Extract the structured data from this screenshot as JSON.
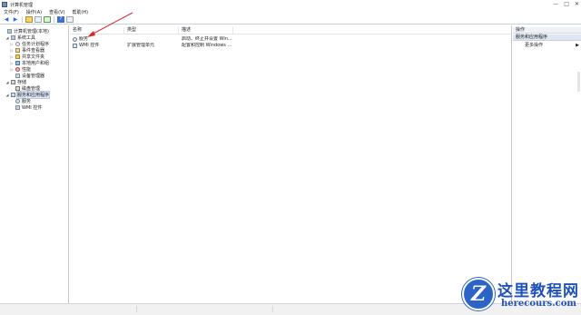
{
  "window": {
    "title": "计算机管理",
    "controls": [
      "—",
      "□",
      "✕"
    ]
  },
  "menu": [
    "文件(F)",
    "操作(A)",
    "查看(V)",
    "帮助(H)"
  ],
  "toolbar": {
    "buttons": [
      "back-arrow-icon",
      "forward-arrow-icon",
      "folder-icon",
      "console-tree-icon",
      "export-icon",
      "help-icon",
      "properties-icon"
    ],
    "glyphs": {
      "back": "◀",
      "forward": "▶",
      "help": "?"
    }
  },
  "tree": [
    {
      "label": "计算机管理(本地)",
      "level": 0,
      "arrow": "",
      "icon": "computer-icon"
    },
    {
      "label": "系统工具",
      "level": 1,
      "arrow": "◢",
      "icon": "system-tools-icon"
    },
    {
      "label": "任务计划程序",
      "level": 2,
      "arrow": "▷",
      "icon": "task-scheduler-icon"
    },
    {
      "label": "事件查看器",
      "level": 2,
      "arrow": "▷",
      "icon": "event-viewer-icon"
    },
    {
      "label": "共享文件夹",
      "level": 2,
      "arrow": "▷",
      "icon": "shared-folder-icon"
    },
    {
      "label": "本地用户和组",
      "level": 2,
      "arrow": "▷",
      "icon": "users-icon"
    },
    {
      "label": "性能",
      "level": 2,
      "arrow": "▷",
      "icon": "performance-icon"
    },
    {
      "label": "设备管理器",
      "level": 2,
      "arrow": "",
      "icon": "device-manager-icon"
    },
    {
      "label": "存储",
      "level": 1,
      "arrow": "◢",
      "icon": "storage-icon"
    },
    {
      "label": "磁盘管理",
      "level": 2,
      "arrow": "",
      "icon": "disk-icon"
    },
    {
      "label": "服务和应用程序",
      "level": 1,
      "arrow": "◢",
      "icon": "services-apps-icon",
      "selected": true
    },
    {
      "label": "服务",
      "level": 2,
      "arrow": "",
      "icon": "services-icon"
    },
    {
      "label": "WMI 控件",
      "level": 2,
      "arrow": "",
      "icon": "wmi-icon"
    }
  ],
  "list": {
    "columns": [
      "名称",
      "类型",
      "描述"
    ],
    "rows": [
      {
        "name": "服务",
        "type": "",
        "desc": "启动、终止并设置 Win...",
        "icon": "gear-icon"
      },
      {
        "name": "WMI 控件",
        "type": "扩展管理单元",
        "desc": "配置和控制 Windows ...",
        "icon": "wmi-icon"
      }
    ]
  },
  "actions": {
    "header": "操作",
    "section": "服务和应用程序",
    "items": [
      {
        "label": "更多操作",
        "arrow": "▶"
      }
    ]
  },
  "watermark": {
    "logo_letter": "Z",
    "text": "这里教程网",
    "url": "herecours.com"
  }
}
